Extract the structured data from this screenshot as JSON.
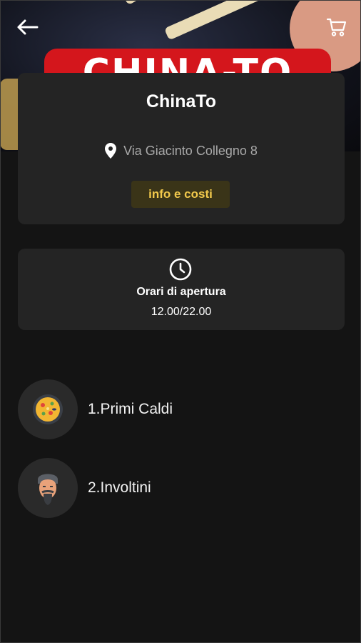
{
  "header": {
    "logo_text": "CHINA-TO",
    "back_icon": "arrow-left-icon",
    "cart_icon": "cart-icon"
  },
  "restaurant": {
    "name": "ChinaTo",
    "address": "Via Giacinto Collegno 8",
    "info_button_label": "info e costi"
  },
  "hours": {
    "label": "Orari di apertura",
    "value": "12.00/22.00"
  },
  "categories": [
    {
      "label": "1.Primi Caldi",
      "icon": "paella-pan-icon"
    },
    {
      "label": "2.Involtini",
      "icon": "chef-face-icon"
    }
  ],
  "colors": {
    "background": "#141414",
    "card": "#242424",
    "accent": "#f2c94c",
    "brand_red": "#d4161c"
  }
}
